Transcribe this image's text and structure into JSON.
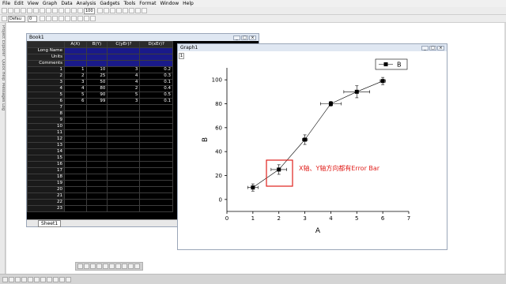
{
  "menubar": [
    "File",
    "Edit",
    "View",
    "Graph",
    "Data",
    "Analysis",
    "Gadgets",
    "Tools",
    "Format",
    "Window",
    "Help"
  ],
  "toolbar": {
    "zoom_value": "100",
    "font_name": "Defau",
    "font_size": "0"
  },
  "left_strip": [
    "Project Explorer",
    "Quick Help",
    "Messages Log"
  ],
  "book": {
    "title": "Book1",
    "columns": [
      "A(X)",
      "B(Y)",
      "C(yEr)?",
      "D(xEr)?"
    ],
    "header_rows": [
      "Long Name",
      "Units",
      "Comments"
    ],
    "rows": [
      [
        "1",
        "1",
        "10",
        "3",
        "0.2"
      ],
      [
        "2",
        "2",
        "25",
        "4",
        "0.3"
      ],
      [
        "3",
        "3",
        "50",
        "4",
        "0.1"
      ],
      [
        "4",
        "4",
        "80",
        "2",
        "0.4"
      ],
      [
        "5",
        "5",
        "90",
        "5",
        "0.5"
      ],
      [
        "6",
        "6",
        "99",
        "3",
        "0.1"
      ],
      [
        "7",
        "",
        "",
        "",
        ""
      ],
      [
        "8",
        "",
        "",
        "",
        ""
      ],
      [
        "9",
        "",
        "",
        "",
        ""
      ],
      [
        "10",
        "",
        "",
        "",
        ""
      ],
      [
        "11",
        "",
        "",
        "",
        ""
      ],
      [
        "12",
        "",
        "",
        "",
        ""
      ],
      [
        "13",
        "",
        "",
        "",
        ""
      ],
      [
        "14",
        "",
        "",
        "",
        ""
      ],
      [
        "15",
        "",
        "",
        "",
        ""
      ],
      [
        "16",
        "",
        "",
        "",
        ""
      ],
      [
        "17",
        "",
        "",
        "",
        ""
      ],
      [
        "18",
        "",
        "",
        "",
        ""
      ],
      [
        "19",
        "",
        "",
        "",
        ""
      ],
      [
        "20",
        "",
        "",
        "",
        ""
      ],
      [
        "21",
        "",
        "",
        "",
        ""
      ],
      [
        "22",
        "",
        "",
        "",
        ""
      ],
      [
        "23",
        "",
        "",
        "",
        ""
      ]
    ],
    "sheet_tab": "Sheet1"
  },
  "graph": {
    "title": "Graph1",
    "layer": "1",
    "annotation": "X轴、Y轴方向都有Error Bar",
    "annotation_color": "#e0201c"
  },
  "chart_data": {
    "type": "scatter",
    "xlabel": "A",
    "ylabel": "B",
    "xlim": [
      0,
      7
    ],
    "ylim": [
      -10,
      110
    ],
    "xticks": [
      0,
      1,
      2,
      3,
      4,
      5,
      6,
      7
    ],
    "yticks": [
      0,
      20,
      40,
      60,
      80,
      100
    ],
    "legend": "top-right",
    "series": [
      {
        "name": "B",
        "x": [
          1,
          2,
          3,
          4,
          5,
          6
        ],
        "y": [
          10,
          25,
          50,
          80,
          90,
          99
        ],
        "yerr": [
          3,
          4,
          4,
          2,
          5,
          3
        ],
        "xerr": [
          0.2,
          0.3,
          0.1,
          0.4,
          0.5,
          0.1
        ]
      }
    ]
  }
}
